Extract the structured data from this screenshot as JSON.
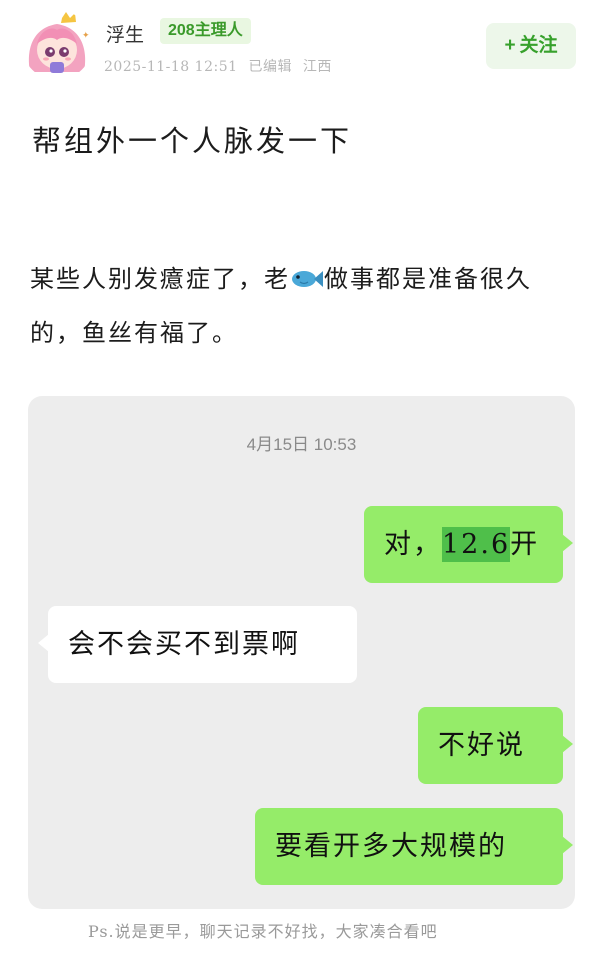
{
  "header": {
    "username": "浮生",
    "role_badge": "208主理人",
    "date": "2025-11-18 12:51",
    "edited": "已编辑",
    "location": "江西",
    "follow_plus": "+",
    "follow_label": "关注"
  },
  "post": {
    "title": "帮组外一个人脉发一下",
    "body_before_emoji": "某些人别发癔症了，老",
    "emoji": "fish-icon",
    "body_after_emoji": "做事都是准备很久的，鱼丝有福了。"
  },
  "chat": {
    "timestamp": "4月15日 10:53",
    "messages": [
      {
        "sender": "me",
        "parts": [
          "对，",
          "12.6",
          "开"
        ]
      },
      {
        "sender": "other",
        "text": "会不会买不到票啊"
      },
      {
        "sender": "me",
        "text": "不好说"
      },
      {
        "sender": "me",
        "text": "要看开多大规模的"
      }
    ]
  },
  "footnote": "Ps.说是更早，聊天记录不好找，大家凑合看吧",
  "colors": {
    "accent_green": "#37a12c",
    "my_bubble": "#95ec69",
    "their_bubble": "#ffffff",
    "chat_background": "#ededed"
  }
}
